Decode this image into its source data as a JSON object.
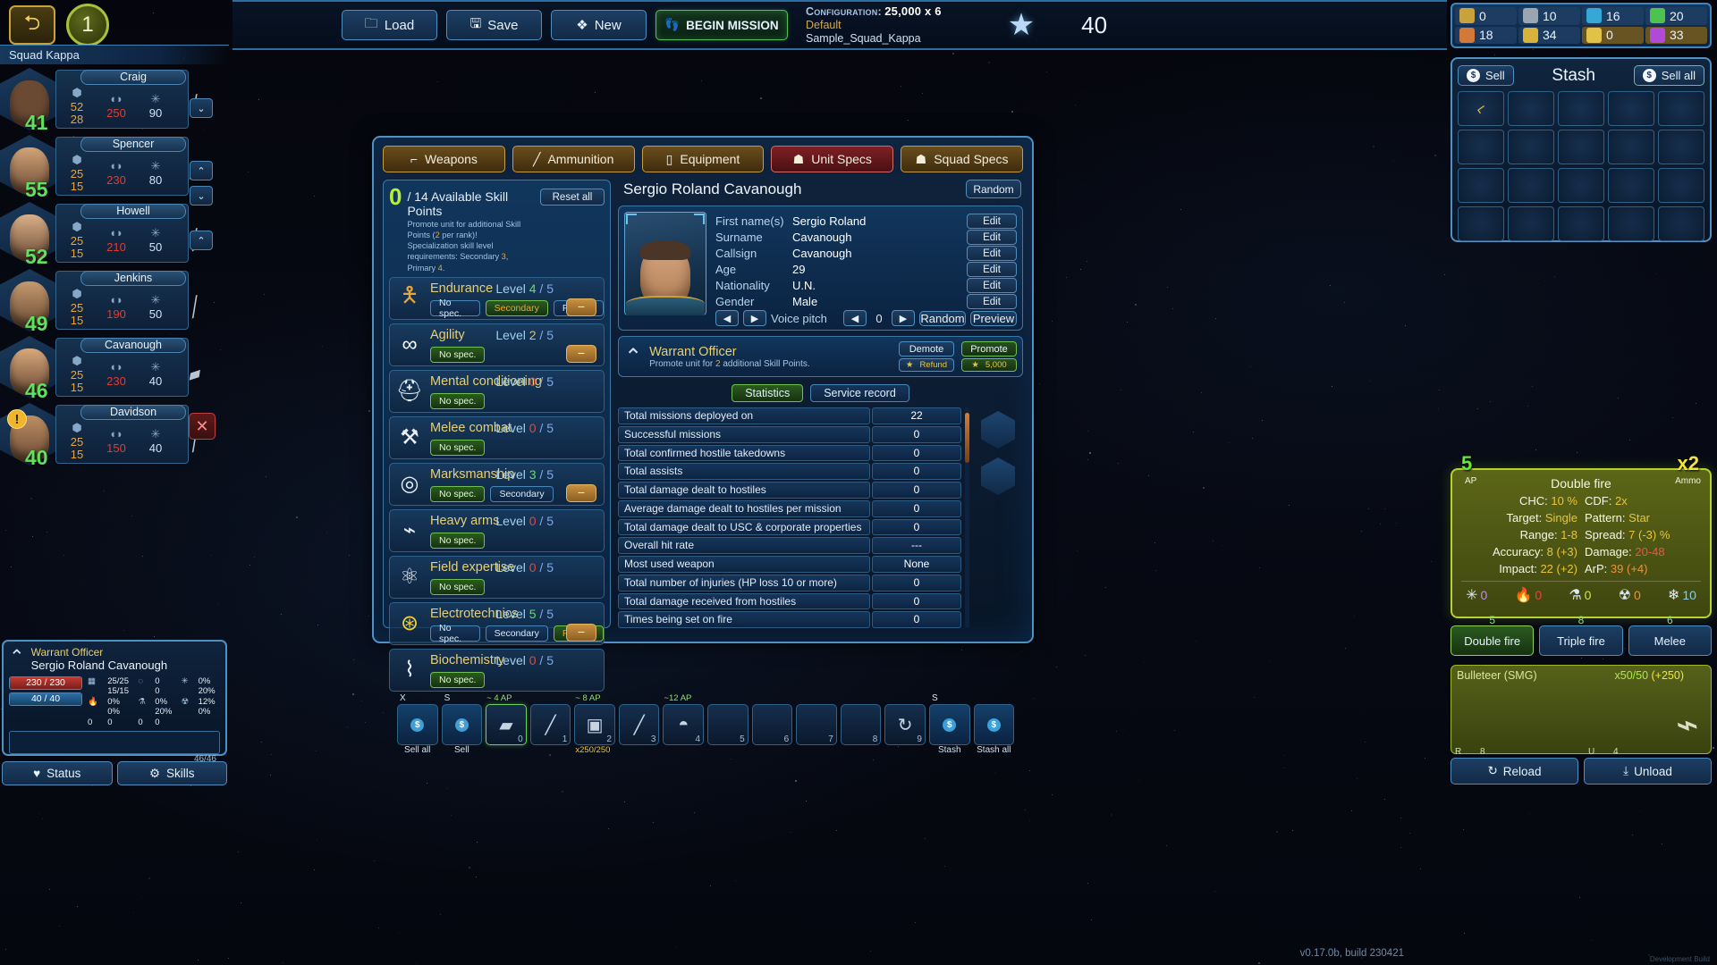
{
  "topbar": {
    "back_icon": "back-arrow-icon",
    "mission_number": "1",
    "buttons": [
      {
        "label": "Load",
        "icon": "folder-icon"
      },
      {
        "label": "Save",
        "icon": "floppy-disk-icon"
      },
      {
        "label": "New",
        "icon": "layers-icon"
      }
    ],
    "begin_mission": {
      "label": "BEGIN MISSION",
      "icon": "boots-icon"
    },
    "configuration": {
      "label": "Configuration:",
      "value": "25,000 x 6",
      "profile": "Default",
      "file": "Sample_Squad_Kappa"
    },
    "star_icon": "star-icon",
    "star_count": "40"
  },
  "resources": [
    {
      "name": "resource-alloy",
      "value": "0",
      "color": "#c9a23c",
      "gold": false
    },
    {
      "name": "resource-parts",
      "value": "10",
      "color": "#9aa7b2",
      "gold": false
    },
    {
      "name": "resource-coil",
      "value": "16",
      "color": "#35a8d8",
      "gold": false
    },
    {
      "name": "resource-chemicals",
      "value": "20",
      "color": "#4ec24e",
      "gold": false
    },
    {
      "name": "resource-explosives",
      "value": "18",
      "color": "#d2793a",
      "gold": false
    },
    {
      "name": "resource-circuits",
      "value": "34",
      "color": "#d8b23a",
      "gold": false
    },
    {
      "name": "resource-credits",
      "value": "0",
      "color": "#e0c24a",
      "gold": true
    },
    {
      "name": "resource-crystals",
      "value": "33",
      "color": "#b04ad8",
      "gold": true
    }
  ],
  "squad": {
    "header": "Squad Kappa",
    "units": [
      {
        "name": "Craig",
        "level": "41",
        "hp": "52",
        "ap": "28",
        "armor": "250",
        "shield": "90",
        "skin": "#6b4a34",
        "hair": "#2a1c12",
        "weapon_icon": "rifle-icon",
        "selected": false,
        "warning": false
      },
      {
        "name": "Spencer",
        "level": "55",
        "hp": "25",
        "ap": "15",
        "armor": "230",
        "shield": "80",
        "skin": "#d2a478",
        "hair": "#1d1410",
        "weapon_icon": "smg-icon",
        "selected": false,
        "warning": false
      },
      {
        "name": "Howell",
        "level": "52",
        "hp": "25",
        "ap": "15",
        "armor": "210",
        "shield": "50",
        "skin": "#d9b089",
        "hair": "#9fd6ea",
        "weapon_icon": "sniper-icon",
        "selected": false,
        "warning": false
      },
      {
        "name": "Jenkins",
        "level": "49",
        "hp": "25",
        "ap": "15",
        "armor": "190",
        "shield": "50",
        "skin": "#c39a6f",
        "hair": "#241a12",
        "weapon_icon": "shotgun-icon",
        "selected": false,
        "warning": false
      },
      {
        "name": "Cavanough",
        "level": "46",
        "hp": "25",
        "ap": "15",
        "armor": "230",
        "shield": "40",
        "skin": "#d7a87c",
        "hair": "#4a3526",
        "weapon_icon": "pistol-icon",
        "selected": true,
        "warning": false
      },
      {
        "name": "Davidson",
        "level": "40",
        "hp": "25",
        "ap": "15",
        "armor": "150",
        "shield": "40",
        "skin": "#bd8f63",
        "hair": "#20170f",
        "weapon_icon": "sniper-icon",
        "selected": false,
        "warning": true
      }
    ]
  },
  "stash": {
    "title": "Stash",
    "sell_label": "Sell",
    "sell_all_label": "Sell all",
    "sell_icon": "coin-icon",
    "sell_all_icon": "money-bag-icon",
    "slots": [
      {
        "item": "crowbar-icon",
        "filled": true
      },
      {
        "item": "",
        "filled": false
      },
      {
        "item": "",
        "filled": false
      },
      {
        "item": "",
        "filled": false
      },
      {
        "item": "",
        "filled": false
      },
      {
        "item": "",
        "filled": false
      },
      {
        "item": "",
        "filled": false
      },
      {
        "item": "",
        "filled": false
      },
      {
        "item": "",
        "filled": false
      },
      {
        "item": "",
        "filled": false
      },
      {
        "item": "",
        "filled": false
      },
      {
        "item": "",
        "filled": false
      },
      {
        "item": "",
        "filled": false
      },
      {
        "item": "",
        "filled": false
      },
      {
        "item": "",
        "filled": false
      },
      {
        "item": "",
        "filled": false
      },
      {
        "item": "",
        "filled": false
      },
      {
        "item": "",
        "filled": false
      },
      {
        "item": "",
        "filled": false
      },
      {
        "item": "",
        "filled": false
      }
    ]
  },
  "center": {
    "tabs": [
      {
        "label": "Weapons",
        "icon": "pistol-icon",
        "active": false
      },
      {
        "label": "Ammunition",
        "icon": "bullet-icon",
        "active": false
      },
      {
        "label": "Equipment",
        "icon": "radio-icon",
        "active": false
      },
      {
        "label": "Unit Specs",
        "icon": "person-gear-icon",
        "active": true
      },
      {
        "label": "Squad Specs",
        "icon": "people-icon",
        "active": false
      }
    ],
    "skill_points": {
      "available": "0",
      "title": "/ 14 Available Skill Points",
      "sub_line1_a": "Promote unit for additional Skill Points (",
      "sub_line1_b": "2",
      "sub_line1_c": " per rank)!",
      "sub_line2_a": "Specialization skill level requirements: Secondary ",
      "sub_line2_b": "3",
      "sub_line2_c": ", Primary ",
      "sub_line2_d": "4",
      "sub_line2_e": ".",
      "reset_label": "Reset all"
    },
    "skills": [
      {
        "name": "Endurance",
        "icon": "armor-suit-icon",
        "level": "4",
        "max": "5",
        "level_class": "lv-g",
        "chips": [
          {
            "label": "No spec.",
            "state": "plain"
          },
          {
            "label": "Secondary",
            "state": "active"
          },
          {
            "label": "Primary",
            "state": "plain"
          }
        ],
        "minus": true
      },
      {
        "name": "Agility",
        "icon": "infinity-icon",
        "level": "2",
        "max": "5",
        "level_class": "lv-y",
        "chips": [
          {
            "label": "No spec.",
            "state": "green"
          }
        ],
        "minus": true
      },
      {
        "name": "Mental conditioning",
        "icon": "helmet-icon",
        "level": "0",
        "max": "5",
        "level_class": "lv-r",
        "chips": [
          {
            "label": "No spec.",
            "state": "green"
          }
        ],
        "minus": false
      },
      {
        "name": "Melee combat",
        "icon": "axe-icon",
        "level": "0",
        "max": "5",
        "level_class": "lv-r",
        "chips": [
          {
            "label": "No spec.",
            "state": "green"
          }
        ],
        "minus": false
      },
      {
        "name": "Marksmanship",
        "icon": "target-icon",
        "level": "3",
        "max": "5",
        "level_class": "lv-g",
        "chips": [
          {
            "label": "No spec.",
            "state": "green"
          },
          {
            "label": "Secondary",
            "state": "plain"
          }
        ],
        "minus": true
      },
      {
        "name": "Heavy arms",
        "icon": "launcher-icon",
        "level": "0",
        "max": "5",
        "level_class": "lv-r",
        "chips": [
          {
            "label": "No spec.",
            "state": "green"
          }
        ],
        "minus": false
      },
      {
        "name": "Field expertise",
        "icon": "molecule-icon",
        "level": "0",
        "max": "5",
        "level_class": "lv-r",
        "chips": [
          {
            "label": "No spec.",
            "state": "green"
          }
        ],
        "minus": false
      },
      {
        "name": "Electrotechnics",
        "icon": "circuit-icon",
        "level": "5",
        "max": "5",
        "level_class": "lv-g",
        "chips": [
          {
            "label": "No spec.",
            "state": "plain"
          },
          {
            "label": "Secondary",
            "state": "plain"
          },
          {
            "label": "Primary",
            "state": "active"
          }
        ],
        "minus": true
      },
      {
        "name": "Biochemistry",
        "icon": "dna-icon",
        "level": "0",
        "max": "5",
        "level_class": "lv-r",
        "chips": [
          {
            "label": "No spec.",
            "state": "green"
          }
        ],
        "minus": false
      }
    ],
    "unit": {
      "full_name": "Sergio Roland Cavanough",
      "random_label": "Random",
      "fields": [
        {
          "key": "First name(s)",
          "value": "Sergio Roland",
          "edit": "Edit"
        },
        {
          "key": "Surname",
          "value": "Cavanough",
          "edit": "Edit"
        },
        {
          "key": "Callsign",
          "value": "Cavanough",
          "edit": "Edit"
        },
        {
          "key": "Age",
          "value": "29",
          "edit": "Edit"
        },
        {
          "key": "Nationality",
          "value": "U.N.",
          "edit": "Edit"
        },
        {
          "key": "Gender",
          "value": "Male",
          "edit": "Edit"
        }
      ],
      "voice": {
        "label": "Voice pitch",
        "value": "0",
        "random_label": "Random",
        "preview_label": "Preview"
      },
      "rank": {
        "title": "Warrant Officer",
        "icon": "chevron-rank-icon",
        "sub_a": "Promote unit for ",
        "sub_b": "2",
        "sub_c": " additional Skill Points.",
        "demote_label": "Demote",
        "refund_label": "Refund",
        "promote_label": "Promote",
        "promote_cost": "5,000"
      },
      "stat_tabs": [
        {
          "label": "Statistics",
          "active": true
        },
        {
          "label": "Service record",
          "active": false
        }
      ],
      "statistics": [
        {
          "key": "Total missions deployed on",
          "value": "22"
        },
        {
          "key": "Successful missions",
          "value": "0"
        },
        {
          "key": "Total confirmed hostile takedowns",
          "value": "0"
        },
        {
          "key": "Total assists",
          "value": "0"
        },
        {
          "key": "Total damage dealt to hostiles",
          "value": "0"
        },
        {
          "key": "Average damage dealt to hostiles per mission",
          "value": "0"
        },
        {
          "key": "Total damage dealt to USC & corporate properties",
          "value": "0"
        },
        {
          "key": "Overall hit rate",
          "value": "---"
        },
        {
          "key": "Most used weapon",
          "value": "None"
        },
        {
          "key": "Total number of injuries (HP loss 10 or more)",
          "value": "0"
        },
        {
          "key": "Total damage received from hostiles",
          "value": "0"
        },
        {
          "key": "Times being set on fire",
          "value": "0"
        }
      ]
    }
  },
  "weapon_card": {
    "mode_name": "Double fire",
    "ap_value": "5",
    "ap_label": "AP",
    "ammo_value": "x2",
    "ammo_label": "Ammo",
    "rows": [
      {
        "lk": "CHC:",
        "lv": "10 %",
        "lc": "wv-y",
        "rk": "CDF:",
        "rv": "2x",
        "rc": "wv-y"
      },
      {
        "lk": "Target:",
        "lv": "Single",
        "lc": "wv-y",
        "rk": "Pattern:",
        "rv": "Star",
        "rc": "wv-y"
      },
      {
        "lk": "Range:",
        "lv": "1-8",
        "lc": "wv-y",
        "rk": "Spread:",
        "rv": "7 (-3) %",
        "rc": "wv-y"
      },
      {
        "lk": "Accuracy:",
        "lv": "8 (+3)",
        "lc": "wv-y",
        "rk": "Damage:",
        "rv": "20-48",
        "rc": "wv-r"
      },
      {
        "lk": "Impact:",
        "lv": "22 (+2)",
        "lc": "wv-y",
        "rk": "ArP:",
        "rv": "39 (+4)",
        "rc": "wv-o"
      }
    ],
    "resistances": [
      {
        "icon": "emp-icon",
        "value": "0",
        "color": "#c58ae8"
      },
      {
        "icon": "fire-icon",
        "value": "0",
        "color": "#e8453a"
      },
      {
        "icon": "acid-icon",
        "value": "0",
        "color": "#c8e84a"
      },
      {
        "icon": "radiation-icon",
        "value": "0",
        "color": "#e8953a"
      },
      {
        "icon": "frost-icon",
        "value": "10",
        "color": "#7fd0f0"
      }
    ],
    "fire_modes": [
      {
        "label": "Double fire",
        "num": "5",
        "active": true
      },
      {
        "label": "Triple fire",
        "num": "8",
        "active": false
      },
      {
        "label": "Melee",
        "num": "6",
        "active": false
      }
    ],
    "equipped": {
      "name": "Bulleteer (SMG)",
      "ammo": "x50/50",
      "ammo_bonus": "(+250)",
      "icon": "smg-icon"
    },
    "bottom_buttons": [
      {
        "label": "Reload",
        "key": "R",
        "num": "8",
        "icon": "reload-icon"
      },
      {
        "label": "Unload",
        "key": "U",
        "num": "4",
        "icon": "unload-icon"
      }
    ]
  },
  "status_panel": {
    "rank_icon": "chevron-rank-icon",
    "rank": "Warrant Officer",
    "name": "Sergio Roland Cavanough",
    "hp_bar": {
      "value": "230 / 230",
      "pct": 100
    },
    "ap_bar": {
      "value": "40 / 40",
      "pct": 100
    },
    "xp_bar": {
      "value": "46/46"
    },
    "stats": [
      {
        "icon": "grid-icon",
        "v1": "25/25",
        "v2": "15/15"
      },
      {
        "icon": "bleed-icon",
        "v1": "0",
        "v2": "0"
      },
      {
        "icon": "emp-icon",
        "v1": "0%",
        "v2": "20%"
      },
      {
        "icon": "fire-icon",
        "v1": "0%",
        "v2": "0%"
      },
      {
        "icon": "acid-icon",
        "v1": "0%",
        "v2": "20%"
      },
      {
        "icon": "radiation-icon",
        "v1": "12%",
        "v2": "0%"
      }
    ],
    "right_values": [
      "0",
      "0",
      "0",
      "0"
    ],
    "buttons": [
      {
        "label": "Status",
        "icon": "heart-pulse-icon"
      },
      {
        "label": "Skills",
        "icon": "gear-person-icon"
      }
    ]
  },
  "inventory_bar": {
    "sell_all": {
      "label": "Sell all",
      "key": "X",
      "icon": "coin-icon"
    },
    "sell": {
      "label": "Sell",
      "key": "S",
      "icon": "coin-icon"
    },
    "slots": [
      {
        "idx": "0",
        "icon": "smg-icon",
        "ap": "~ 4 AP",
        "qty": "",
        "active": true
      },
      {
        "idx": "1",
        "icon": "knife-icon",
        "ap": "",
        "qty": "",
        "active": false
      },
      {
        "idx": "2",
        "icon": "ammo-box-icon",
        "ap": "~ 8 AP",
        "qty": "x250/250",
        "active": false
      },
      {
        "idx": "3",
        "icon": "blade-icon",
        "ap": "",
        "qty": "",
        "active": false
      },
      {
        "idx": "4",
        "icon": "grenade-icon",
        "ap": "~12 AP",
        "qty": "",
        "active": false
      },
      {
        "idx": "5",
        "icon": "",
        "ap": "",
        "qty": "",
        "active": false
      },
      {
        "idx": "6",
        "icon": "",
        "ap": "",
        "qty": "",
        "active": false
      },
      {
        "idx": "7",
        "icon": "",
        "ap": "",
        "qty": "",
        "active": false
      },
      {
        "idx": "8",
        "icon": "",
        "ap": "",
        "qty": "",
        "active": false
      },
      {
        "idx": "9",
        "icon": "refresh-icon",
        "ap": "",
        "qty": "",
        "active": false
      }
    ],
    "stash_btn": {
      "label": "Stash",
      "key": "S",
      "icon": "box-icon"
    },
    "stash_all_btn": {
      "label": "Stash all",
      "key": "",
      "icon": "boxes-icon"
    }
  },
  "footer": {
    "version": "v0.17.0b, build 230421",
    "dev_build": "Development Build"
  }
}
